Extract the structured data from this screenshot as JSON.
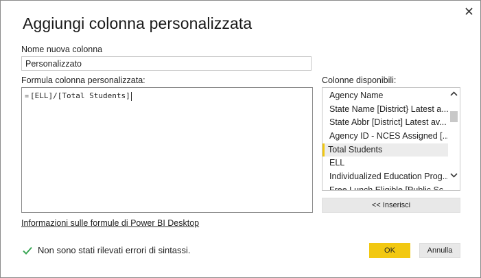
{
  "dialog": {
    "title": "Aggiungi colonna personalizzata",
    "close_icon": "close-icon"
  },
  "name_field": {
    "label": "Nome nuova colonna",
    "value": "Personalizzato"
  },
  "formula": {
    "label": "Formula colonna personalizzata:",
    "prefix": "=",
    "value": "[ELL]/[Total Students]"
  },
  "columns": {
    "label": "Colonne disponibili:",
    "items": [
      "Agency Name",
      "State Name [District} Latest a...",
      "State Abbr [District] Latest av...",
      "Agency ID - NCES Assigned [...",
      "Total Students",
      "ELL",
      "Individualized Education Prog...",
      "Free Lunch Eligible [Public Sc..."
    ],
    "selected_index": 4,
    "insert_label": "<< Inserisci"
  },
  "info_link": "Informazioni sulle formule di Power BI Desktop",
  "status": {
    "icon": "checkmark-icon",
    "text": "Non sono stati rilevati errori di sintassi."
  },
  "buttons": {
    "ok": "OK",
    "cancel": "Annulla"
  },
  "colors": {
    "accent": "#f2c811",
    "check": "#3aa655"
  }
}
